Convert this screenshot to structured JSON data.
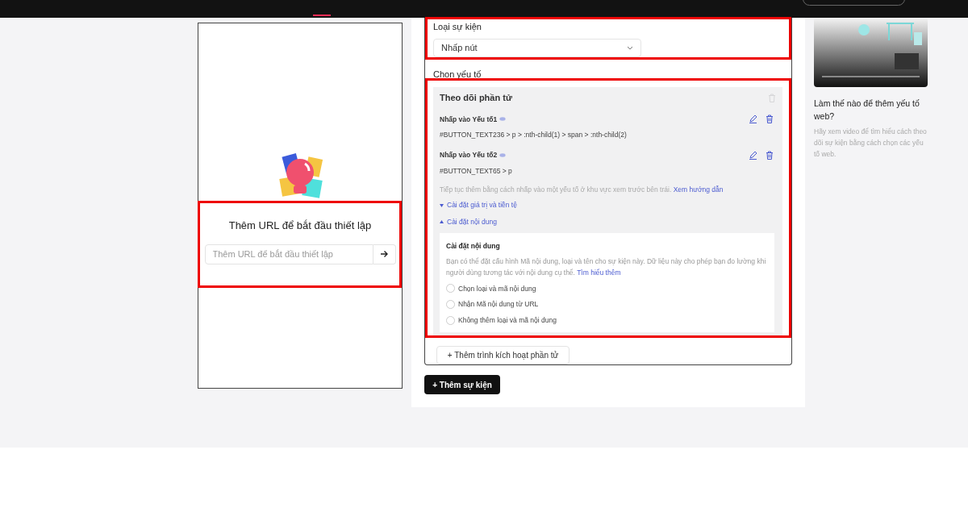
{
  "preview": {
    "heading": "Thêm URL để bắt đầu thiết lập",
    "url_field": {
      "placeholder": "Thêm URL để bắt đầu thiết lập"
    }
  },
  "event": {
    "type_label": "Loại sự kiện",
    "type_value": "Nhấp nút",
    "element_label": "Chọn yếu tố",
    "tracking": {
      "title": "Theo dõi phần tử",
      "elements": [
        {
          "title": "Nhấp vào Yếu tố1",
          "selector": "#BUTTON_TEXT236 > p > :nth-child(1) > span > :nth-child(2)"
        },
        {
          "title": "Nhấp vào Yếu tố2",
          "selector": "#BUTTON_TEXT65 > p"
        }
      ],
      "hint": "Tiếp tục thêm bằng cách nhấp vào một yếu tố ở khu vực xem trước bên trái.",
      "hint_link": "Xem hướng dẫn",
      "sections": [
        {
          "label": "Cài đặt giá trị và tiền tệ",
          "expanded": false
        },
        {
          "label": "Cài đặt nội dung",
          "expanded": true
        }
      ],
      "content": {
        "title": "Cài đặt nội dung",
        "description": "Bạn có thể đặt cấu hình Mã nội dung, loại và tên cho sự kiện này. Dữ liệu này cho phép bạn đo lường khi người dùng tương tác với nội dung cụ thể.",
        "link": "Tìm hiểu thêm",
        "options": [
          {
            "label": "Chọn loại và mã nội dung",
            "selected": false
          },
          {
            "label": "Nhận Mã nội dung từ URL",
            "selected": false
          },
          {
            "label": "Không thêm loại và mã nội dung",
            "selected": false
          }
        ]
      }
    },
    "add_trigger": "+ Thêm trình kích hoạt phần tử"
  },
  "add_event": "+ Thêm sự kiện",
  "help": {
    "title": "Làm thế nào để thêm yếu tố web?",
    "description": "Hãy xem video để tìm hiểu cách theo dõi sự kiện bằng cách chọn các yếu tố web."
  }
}
